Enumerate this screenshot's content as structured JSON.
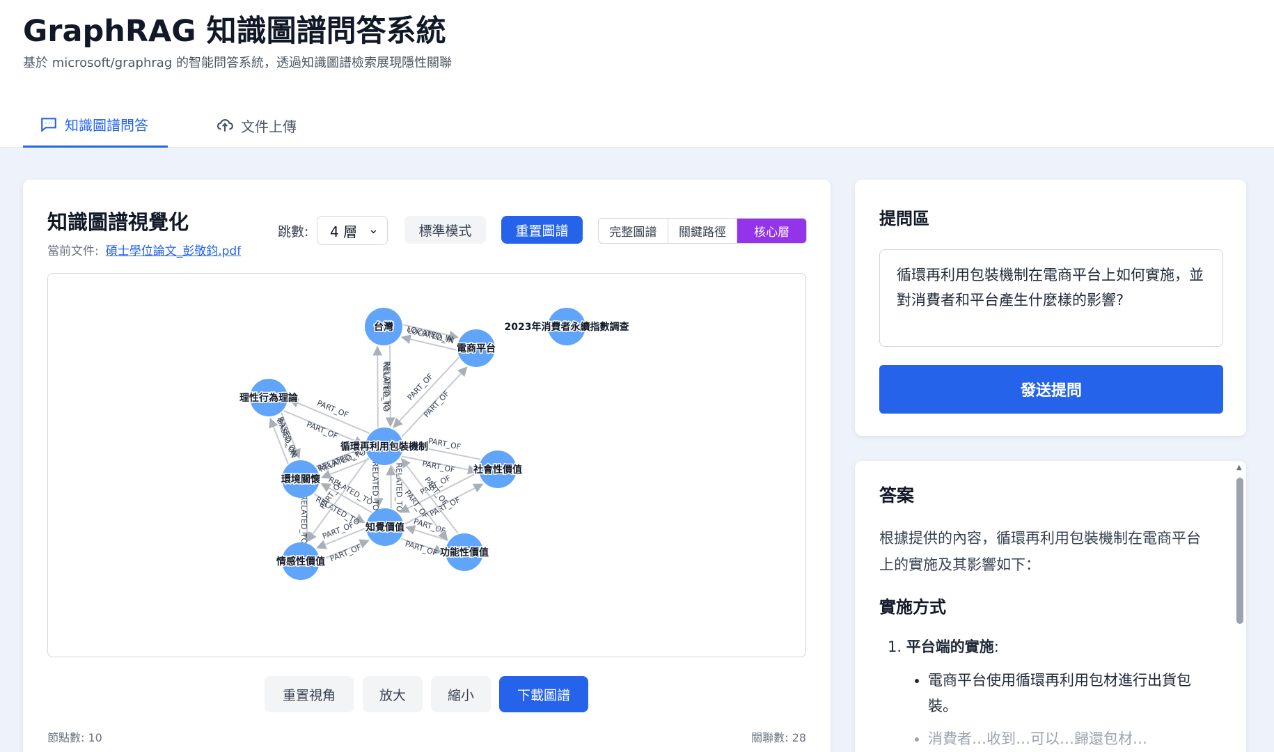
{
  "app": {
    "title": "GraphRAG 知識圖譜問答系統",
    "subtitle": "基於 microsoft/graphrag 的智能問答系統，透過知識圖譜檢索展現隱性關聯"
  },
  "tabs": [
    {
      "label": "知識圖譜問答",
      "icon": "chat-icon",
      "active": true
    },
    {
      "label": "文件上傳",
      "icon": "upload-cloud-icon",
      "active": false
    }
  ],
  "graph_panel": {
    "title": "知識圖譜視覺化",
    "current_doc_label": "當前文件:",
    "current_doc_name": "碩士學位論文_彭敬鈞.pdf",
    "hops_label": "跳數:",
    "hops_value": "4 層",
    "mode_button": "標準模式",
    "reset_graph_button": "重置圖譜",
    "view_modes": [
      "完整圖譜",
      "關鍵路徑",
      "核心層"
    ],
    "active_view_mode": "核心層",
    "controls": {
      "reset_view": "重置視角",
      "zoom_in": "放大",
      "zoom_out": "縮小",
      "download": "下載圖譜"
    },
    "stats": {
      "nodes": "節點數: 10",
      "edges": "關聯數: 28"
    }
  },
  "graph": {
    "node_color": "#60a5fa",
    "edge_color": "#c7cbd1",
    "nodes": [
      {
        "id": "taiwan",
        "label": "台灣"
      },
      {
        "id": "ecommerce",
        "label": "電商平台"
      },
      {
        "id": "survey",
        "label": "2023年消費者永續指數調查"
      },
      {
        "id": "rational",
        "label": "理性行為理論"
      },
      {
        "id": "circular",
        "label": "循環再利用包裝機制"
      },
      {
        "id": "social",
        "label": "社會性價值"
      },
      {
        "id": "env",
        "label": "環境關懷"
      },
      {
        "id": "perceived",
        "label": "知覺價值"
      },
      {
        "id": "emotional",
        "label": "情感性價值"
      },
      {
        "id": "functional",
        "label": "功能性價值"
      }
    ],
    "edges": [
      {
        "source": "taiwan",
        "target": "ecommerce",
        "label": "LOCATED_IN"
      },
      {
        "source": "ecommerce",
        "target": "taiwan",
        "label": "LOCATED_IN"
      },
      {
        "source": "taiwan",
        "target": "circular",
        "label": "RELATED_TO"
      },
      {
        "source": "circular",
        "target": "taiwan",
        "label": "RELATED_TO"
      },
      {
        "source": "circular",
        "target": "ecommerce",
        "label": "PART_OF"
      },
      {
        "source": "ecommerce",
        "target": "circular",
        "label": "PART_OF"
      },
      {
        "source": "circular",
        "target": "rational",
        "label": "PART_OF"
      },
      {
        "source": "rational",
        "target": "circular",
        "label": "PART_OF"
      },
      {
        "source": "rational",
        "target": "env",
        "label": "BASED_ON"
      },
      {
        "source": "env",
        "target": "rational",
        "label": "BASED_ON"
      },
      {
        "source": "circular",
        "target": "social",
        "label": "PART_OF"
      },
      {
        "source": "social",
        "target": "circular",
        "label": "PART_OF"
      },
      {
        "source": "env",
        "target": "circular",
        "label": "RELATED_TO"
      },
      {
        "source": "circular",
        "target": "env",
        "label": "RELATED_TO"
      },
      {
        "source": "env",
        "target": "perceived",
        "label": "RELATED_TO"
      },
      {
        "source": "perceived",
        "target": "env",
        "label": "RELATED_TO"
      },
      {
        "source": "circular",
        "target": "perceived",
        "label": "RELATED_TO"
      },
      {
        "source": "perceived",
        "target": "circular",
        "label": "RELATED_TO"
      },
      {
        "source": "perceived",
        "target": "social",
        "label": "PART_OF"
      },
      {
        "source": "social",
        "target": "perceived",
        "label": "PART_OF"
      },
      {
        "source": "functional",
        "target": "perceived",
        "label": "PART_OF"
      },
      {
        "source": "perceived",
        "target": "functional",
        "label": "PART_OF"
      },
      {
        "source": "emotional",
        "target": "perceived",
        "label": "PART_OF"
      },
      {
        "source": "perceived",
        "target": "emotional",
        "label": "PART_OF"
      },
      {
        "source": "env",
        "target": "emotional",
        "label": "RELATED_TO"
      },
      {
        "source": "circular",
        "target": "functional",
        "label": "PART_OF"
      },
      {
        "source": "functional",
        "target": "circular",
        "label": "PART_OF"
      },
      {
        "source": "circular",
        "target": "emotional",
        "label": "PART_OF"
      }
    ]
  },
  "ask_panel": {
    "title": "提問區",
    "question": "循環再利用包裝機制在電商平台上如何實施，並對消費者和平台產生什麼樣的影響?",
    "send_button": "發送提問"
  },
  "answer_panel": {
    "title": "答案",
    "intro": "根據提供的內容，循環再利用包裝機制在電商平台上的實施及其影響如下：",
    "section_title": "實施方式",
    "item1_title": "平台端的實施",
    "item1_bullet1": "電商平台使用循環再利用包材進行出貨包裝。",
    "item1_bullet2": "消費者…收到…可以…歸還包材…"
  },
  "colors": {
    "accent": "#2563eb",
    "purple": "#9333ea",
    "background": "#eef3fb"
  }
}
